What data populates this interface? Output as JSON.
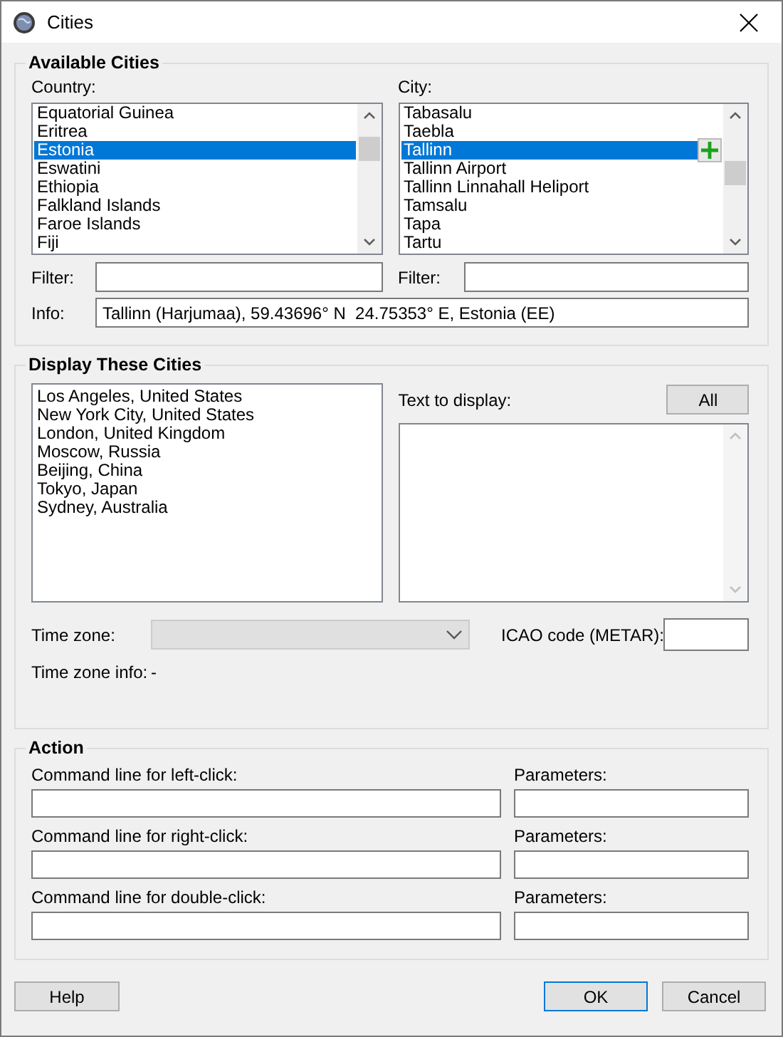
{
  "window": {
    "title": "Cities"
  },
  "available_cities": {
    "title": "Available Cities",
    "country": {
      "label": "Country:",
      "filter_label": "Filter:",
      "items": [
        {
          "label": "Equatorial Guinea",
          "selected": false
        },
        {
          "label": "Eritrea",
          "selected": false
        },
        {
          "label": "Estonia",
          "selected": true
        },
        {
          "label": "Eswatini",
          "selected": false
        },
        {
          "label": "Ethiopia",
          "selected": false
        },
        {
          "label": "Falkland Islands",
          "selected": false
        },
        {
          "label": "Faroe Islands",
          "selected": false
        },
        {
          "label": "Fiji",
          "selected": false
        }
      ]
    },
    "city": {
      "label": "City:",
      "filter_label": "Filter:",
      "items": [
        {
          "label": "Tabasalu",
          "selected": false
        },
        {
          "label": "Taebla",
          "selected": false
        },
        {
          "label": "Tallinn",
          "selected": true
        },
        {
          "label": "Tallinn Airport",
          "selected": false
        },
        {
          "label": "Tallinn Linnahall Heliport",
          "selected": false
        },
        {
          "label": "Tamsalu",
          "selected": false
        },
        {
          "label": "Tapa",
          "selected": false
        },
        {
          "label": "Tartu",
          "selected": false
        }
      ]
    },
    "info": {
      "label": "Info:",
      "value": "Tallinn (Harjumaa), 59.43696° N  24.75353° E, Estonia (EE)"
    }
  },
  "display": {
    "title": "Display These Cities",
    "cities": [
      "Los Angeles, United States",
      "New York City, United States",
      "London, United Kingdom",
      "Moscow, Russia",
      "Beijing, China",
      "Tokyo, Japan",
      "Sydney, Australia"
    ],
    "text_label": "Text to display:",
    "all_button": "All",
    "time_zone": {
      "label": "Time zone:",
      "disabled": true
    },
    "icao_label": "ICAO code (METAR):",
    "time_zone_info": {
      "label": "Time zone info:",
      "value": "-"
    }
  },
  "action": {
    "title": "Action",
    "rows": [
      {
        "label": "Command line for left-click:",
        "param_label": "Parameters:"
      },
      {
        "label": "Command line for right-click:",
        "param_label": "Parameters:"
      },
      {
        "label": "Command line for double-click:",
        "param_label": "Parameters:"
      }
    ]
  },
  "buttons": {
    "help": "Help",
    "ok": "OK",
    "cancel": "Cancel"
  }
}
